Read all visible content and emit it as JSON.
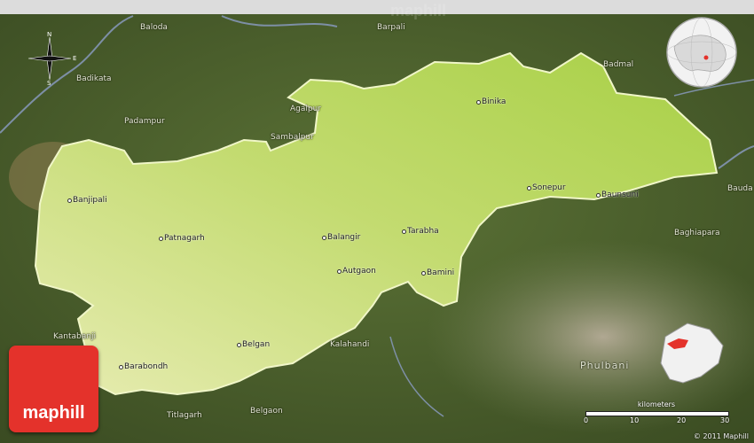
{
  "watermark": "maphill",
  "logo": {
    "text": "maphill",
    "color": "#e4322b"
  },
  "colors": {
    "district": "#bfd86a",
    "district_edge": "#f0f6c8",
    "terrain": "#4d6330",
    "relief": "#a69a82",
    "river": "#7d8fa6"
  },
  "compass": {
    "n": "N",
    "s": "S",
    "e": "E",
    "w": "W"
  },
  "places": [
    {
      "name": "Baloda",
      "outside": true
    },
    {
      "name": "Barpali",
      "outside": true
    },
    {
      "name": "Badmal",
      "outside": true
    },
    {
      "name": "Badikata",
      "outside": true
    },
    {
      "name": "Agalpur",
      "outside": true
    },
    {
      "name": "Binika",
      "outside": false
    },
    {
      "name": "Padampur",
      "outside": true
    },
    {
      "name": "Sambalpur",
      "outside": true
    },
    {
      "name": "Sonepur",
      "outside": false
    },
    {
      "name": "Baunsuni",
      "outside": false
    },
    {
      "name": "Bauda",
      "outside": true
    },
    {
      "name": "Banjipali",
      "outside": false
    },
    {
      "name": "Baghiapara",
      "outside": true
    },
    {
      "name": "Patnagarh",
      "outside": false
    },
    {
      "name": "Balangir",
      "outside": false
    },
    {
      "name": "Tarabha",
      "outside": false
    },
    {
      "name": "Autgaon",
      "outside": false
    },
    {
      "name": "Bamini",
      "outside": false
    },
    {
      "name": "Kantabanji",
      "outside": true
    },
    {
      "name": "Belgan",
      "outside": false
    },
    {
      "name": "Kalahandi",
      "outside": true
    },
    {
      "name": "Barabondh",
      "outside": false
    },
    {
      "name": "Phulbani",
      "outside": true
    },
    {
      "name": "Titlagarh",
      "outside": true
    },
    {
      "name": "Belgaon",
      "outside": true
    }
  ],
  "scale": {
    "title": "kilometers",
    "ticks": [
      "0",
      "10",
      "20",
      "30"
    ]
  },
  "copyright": "© 2011 Maphill"
}
